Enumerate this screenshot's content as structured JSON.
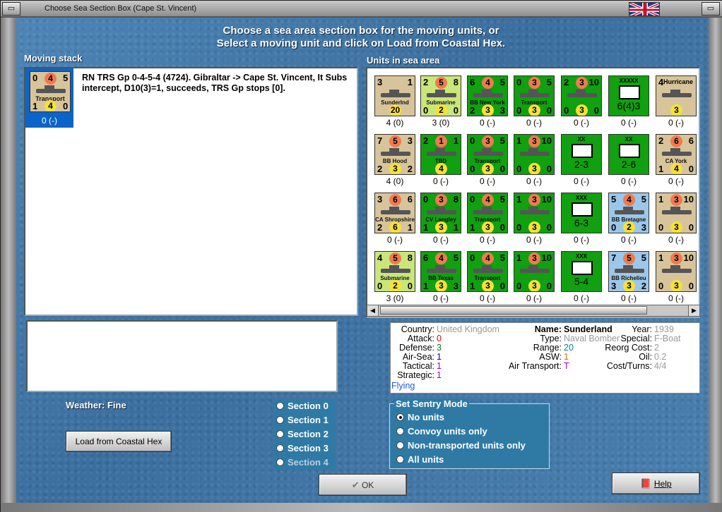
{
  "window": {
    "title": "Choose Sea Section Box (Cape St. Vincent)"
  },
  "heading": {
    "line1": "Choose a sea area section box for the moving units, or",
    "line2": "Select a moving unit and click on Load from Coastal Hex."
  },
  "moving_stack": {
    "label": "Moving stack",
    "unit": {
      "v1": "0",
      "v2": "4",
      "v3": "5",
      "name": "Transport",
      "b1": "1",
      "b2": "4",
      "b3": "0",
      "caption": "0 (-)"
    },
    "text": "RN TRS Gp 0-4-5-4 (4724).  Gibraltar -> Cape St. Vincent, It Subs intercept, D10(3)=1, succeeds, TRS Gp stops [0]."
  },
  "sea_area": {
    "label": "Units in sea area",
    "units": [
      {
        "c": "tan",
        "t": [
          "3",
          "",
          "1"
        ],
        "name": "SunderInd",
        "b": [
          "",
          "20",
          ""
        ],
        "cap": "4 (0)"
      },
      {
        "c": "lgreen",
        "t": [
          "2",
          "5",
          "8"
        ],
        "name": "Submarine",
        "b": [
          "0",
          "2",
          "0"
        ],
        "cap": "3 (0)"
      },
      {
        "c": "green",
        "t": [
          "6",
          "4",
          "5"
        ],
        "name": "BB New York",
        "b": [
          "2",
          "3",
          "3"
        ],
        "cap": "0 (-)"
      },
      {
        "c": "green",
        "t": [
          "0",
          "3",
          "5"
        ],
        "name": "Transport",
        "b": [
          "0",
          "3",
          "0"
        ],
        "cap": "0 (-)"
      },
      {
        "c": "green",
        "t": [
          "2",
          "3",
          "10"
        ],
        "name": "",
        "b": [
          "0",
          "3",
          "0"
        ],
        "cap": "0 (-)"
      },
      {
        "c": "green",
        "t": [
          "",
          "XXXXX",
          ""
        ],
        "name": "6(4)3",
        "b": [
          "",
          "",
          ""
        ],
        "cap": "0 (-)"
      },
      {
        "c": "tan",
        "t": [
          "4",
          "Hurricane",
          ""
        ],
        "name": "",
        "b": [
          "",
          "3",
          ""
        ],
        "cap": "0 (-)"
      },
      {
        "c": "tan",
        "t": [
          "7",
          "5",
          "3"
        ],
        "name": "BB Hood",
        "b": [
          "2",
          "3",
          "2"
        ],
        "cap": "4 (0)"
      },
      {
        "c": "green",
        "t": [
          "2",
          "1",
          "1"
        ],
        "name": "TBD",
        "b": [
          "",
          "4",
          ""
        ],
        "cap": "0 (-)"
      },
      {
        "c": "green",
        "t": [
          "0",
          "3",
          "5"
        ],
        "name": "Transport",
        "b": [
          "0",
          "3",
          "0"
        ],
        "cap": "0 (-)"
      },
      {
        "c": "green",
        "t": [
          "1",
          "3",
          "10"
        ],
        "name": "",
        "b": [
          "0",
          "3",
          "0"
        ],
        "cap": "0 (-)"
      },
      {
        "c": "green",
        "t": [
          "",
          "XX",
          ""
        ],
        "name": "2-3",
        "b": [
          "",
          "",
          ""
        ],
        "cap": "0 (-)"
      },
      {
        "c": "green",
        "t": [
          "",
          "XX",
          ""
        ],
        "name": "2-6",
        "b": [
          "",
          "",
          ""
        ],
        "cap": "0 (-)"
      },
      {
        "c": "tan",
        "t": [
          "2",
          "6",
          "6"
        ],
        "name": "CA York",
        "b": [
          "1",
          "4",
          "0"
        ],
        "cap": "0 (-)"
      },
      {
        "c": "tan",
        "t": [
          "3",
          "6",
          "6"
        ],
        "name": "CA Shropshire",
        "b": [
          "2",
          "6",
          "1"
        ],
        "cap": "0 (-)"
      },
      {
        "c": "green",
        "t": [
          "0",
          "3",
          "8"
        ],
        "name": "CV Langley",
        "b": [
          "1",
          "3",
          "1"
        ],
        "cap": "0 (-)"
      },
      {
        "c": "green",
        "t": [
          "0",
          "4",
          "5"
        ],
        "name": "Transport",
        "b": [
          "1",
          "3",
          "0"
        ],
        "cap": "0 (-)"
      },
      {
        "c": "green",
        "t": [
          "1",
          "3",
          "10"
        ],
        "name": "",
        "b": [
          "0",
          "3",
          "0"
        ],
        "cap": "0 (-)"
      },
      {
        "c": "green",
        "t": [
          "",
          "XXX",
          ""
        ],
        "name": "6-3",
        "b": [
          "",
          "",
          ""
        ],
        "cap": "0 (-)"
      },
      {
        "c": "lblue",
        "t": [
          "5",
          "4",
          "5"
        ],
        "name": "BB Bretagne",
        "b": [
          "0",
          "2",
          "3"
        ],
        "cap": "0 (-)"
      },
      {
        "c": "tan",
        "t": [
          "1",
          "3",
          "10"
        ],
        "name": "",
        "b": [
          "0",
          "3",
          "0"
        ],
        "cap": "0 (-)"
      },
      {
        "c": "lgreen",
        "t": [
          "4",
          "5",
          "8"
        ],
        "name": "Submarine",
        "b": [
          "0",
          "2",
          "0"
        ],
        "cap": "3 (0)"
      },
      {
        "c": "green",
        "t": [
          "6",
          "4",
          "5"
        ],
        "name": "BB Texas",
        "b": [
          "1",
          "3",
          "3"
        ],
        "cap": "0 (-)"
      },
      {
        "c": "green",
        "t": [
          "0",
          "4",
          "5"
        ],
        "name": "Transport",
        "b": [
          "1",
          "3",
          "0"
        ],
        "cap": "0 (-)"
      },
      {
        "c": "green",
        "t": [
          "1",
          "3",
          "10"
        ],
        "name": "",
        "b": [
          "0",
          "3",
          "0"
        ],
        "cap": "0 (-)"
      },
      {
        "c": "green",
        "t": [
          "",
          "XXX",
          ""
        ],
        "name": "5-4",
        "b": [
          "",
          "",
          ""
        ],
        "cap": "0 (-)"
      },
      {
        "c": "lblue",
        "t": [
          "7",
          "5",
          "5"
        ],
        "name": "BB Richelieu",
        "b": [
          "3",
          "3",
          "2"
        ],
        "cap": "0 (-)"
      },
      {
        "c": "tan",
        "t": [
          "1",
          "3",
          "10"
        ],
        "name": "",
        "b": [
          "0",
          "3",
          "0"
        ],
        "cap": "0 (-)"
      }
    ]
  },
  "info": {
    "country_label": "Country:",
    "country": "United Kingdom",
    "attack_label": "Attack:",
    "attack": "0",
    "defense_label": "Defense:",
    "defense": "3",
    "airsea_label": "Air-Sea:",
    "airsea": "1",
    "tactical_label": "Tactical:",
    "tactical": "1",
    "strategic_label": "Strategic:",
    "strategic": "1",
    "status": "Flying",
    "name_label": "Name:",
    "name": "Sunderland",
    "type_label": "Type:",
    "type": "Naval Bomber",
    "range_label": "Range:",
    "range": "20",
    "asw_label": "ASW:",
    "asw": "1",
    "airtrans_label": "Air Transport:",
    "airtrans": "T",
    "year_label": "Year:",
    "year": "1939",
    "special_label": "Special:",
    "special": "F-Boat",
    "reorg_label": "Reorg Cost:",
    "reorg": "2",
    "oil_label": "Oil:",
    "oil": "0.2",
    "cost_label": "Cost/Turns:",
    "cost": "4/4"
  },
  "weather": "Weather: Fine",
  "sections": [
    "Section 0",
    "Section 1",
    "Section 2",
    "Section 3",
    "Section 4"
  ],
  "sentry": {
    "legend": "Set Sentry Mode",
    "options": [
      "No units",
      "Convoy units only",
      "Non-transported units only",
      "All units"
    ]
  },
  "buttons": {
    "load": "Load from Coastal Hex",
    "ok": "OK",
    "help": "Help"
  }
}
